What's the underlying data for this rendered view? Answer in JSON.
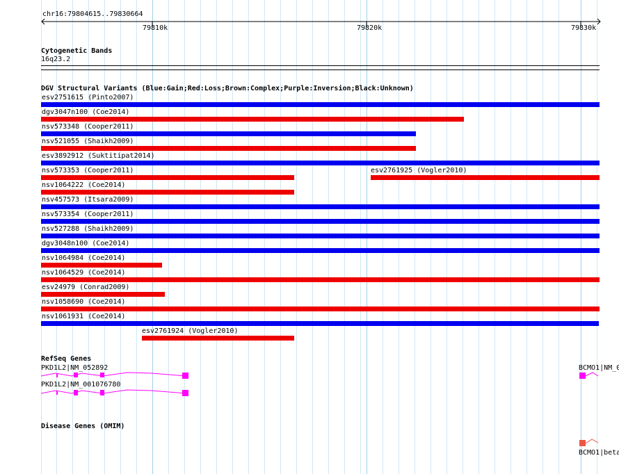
{
  "ruler": {
    "region": "chr16:79804615..79830664",
    "ticks": [
      "79810k",
      "79820k",
      "79830k"
    ]
  },
  "cytoband": {
    "title": "Cytogenetic Bands",
    "band": "16q23.2"
  },
  "dgv": {
    "title": "DGV Structural Variants (Blue:Gain;Red:Loss;Brown:Complex;Purple:Inversion;Black:Unknown)",
    "variants": [
      {
        "label": "esv2751615 (Pinto2007)",
        "type": "gain"
      },
      {
        "label": "dgv3047n100 (Coe2014)",
        "type": "loss"
      },
      {
        "label": "nsv573348 (Cooper2011)",
        "type": "gain"
      },
      {
        "label": "nsv521055 (Shaikh2009)",
        "type": "loss"
      },
      {
        "label": "esv3892912 (Suktitipat2014)",
        "type": "gain"
      },
      {
        "label": "nsv573353 (Cooper2011)",
        "type": "loss"
      },
      {
        "label": "esv2761925 (Vogler2010)",
        "type": "loss"
      },
      {
        "label": "nsv1064222 (Coe2014)",
        "type": "loss"
      },
      {
        "label": "nsv457573 (Itsara2009)",
        "type": "gain"
      },
      {
        "label": "nsv573354 (Cooper2011)",
        "type": "gain"
      },
      {
        "label": "nsv527288 (Shaikh2009)",
        "type": "gain"
      },
      {
        "label": "dgv3048n100 (Coe2014)",
        "type": "gain"
      },
      {
        "label": "nsv1064984 (Coe2014)",
        "type": "loss"
      },
      {
        "label": "nsv1064529 (Coe2014)",
        "type": "loss"
      },
      {
        "label": "esv24979 (Conrad2009)",
        "type": "loss"
      },
      {
        "label": "nsv1058690 (Coe2014)",
        "type": "loss"
      },
      {
        "label": "nsv1061931 (Coe2014)",
        "type": "gain"
      },
      {
        "label": "esv2761924 (Vogler2010)",
        "type": "loss"
      }
    ]
  },
  "refseq": {
    "title": "RefSeq Genes",
    "genes": [
      "PKD1L2|NM_052892",
      "PKD1L2|NM_001076780",
      "BCMO1|NM_0"
    ]
  },
  "omim": {
    "title": "Disease Genes (OMIM)",
    "genes": [
      "BCMO1|beta"
    ]
  },
  "colors": {
    "gain": "#0000ee",
    "loss": "#ee0000",
    "gene": "#ff00ff",
    "omim": "#ee5544",
    "grid": "#cfe8f4"
  }
}
